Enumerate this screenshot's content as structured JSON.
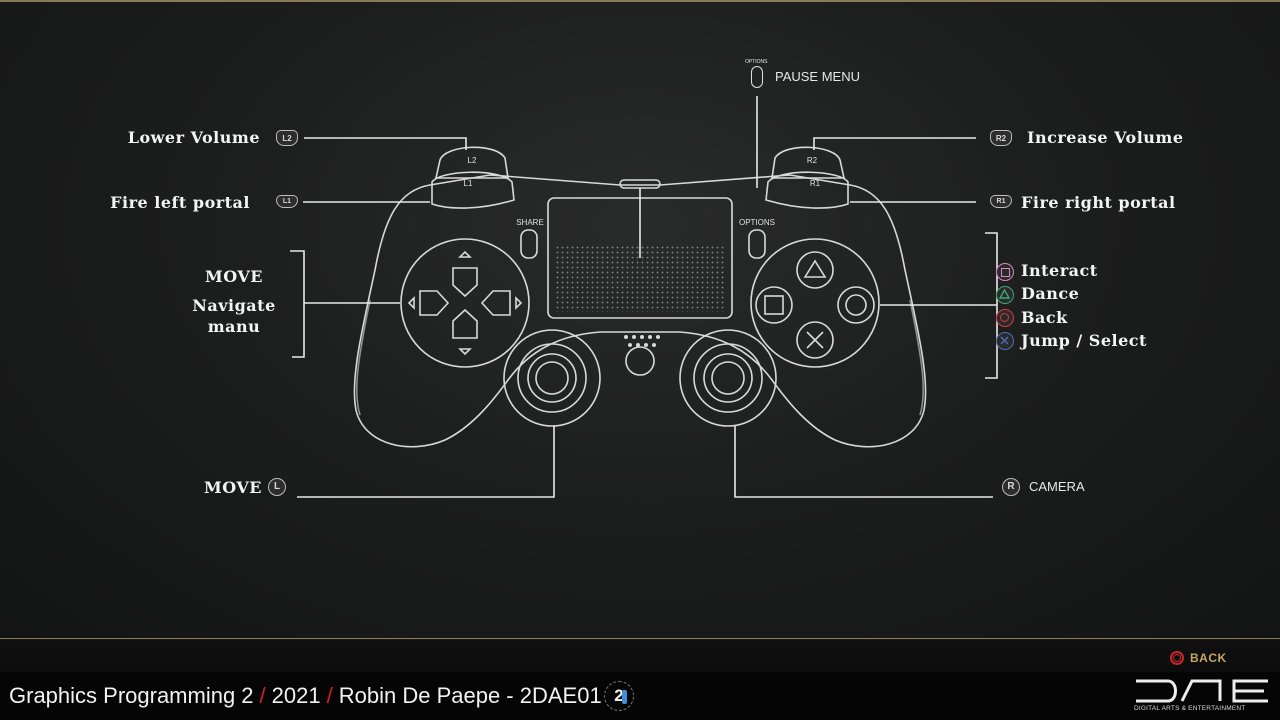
{
  "controls": {
    "left": {
      "l2": {
        "label": "Lower Volume",
        "badge": "L2"
      },
      "l1": {
        "label": "Fire left portal",
        "badge": "L1"
      },
      "dpad": {
        "line1": "MOVE",
        "line2": "Navigate",
        "line3": "manu"
      },
      "left_stick": {
        "label": "MOVE",
        "badge": "L"
      }
    },
    "right": {
      "r2": {
        "label": "Increase Volume",
        "badge": "R2"
      },
      "r1": {
        "label": "Fire right portal",
        "badge": "R1"
      },
      "face": [
        {
          "label": "Interact",
          "symbol": "square",
          "color": "#d889c7"
        },
        {
          "label": "Dance",
          "symbol": "triangle",
          "color": "#3fa67a"
        },
        {
          "label": "Back",
          "symbol": "circle",
          "color": "#d23a3f"
        },
        {
          "label": "Jump / Select",
          "symbol": "cross",
          "color": "#4c6fb4"
        }
      ],
      "right_stick": {
        "label": "CAMERA",
        "badge": "R"
      }
    },
    "options": {
      "label": "PAUSE MENU",
      "small": "OPTIONS"
    }
  },
  "controller_text": {
    "share": "SHARE",
    "options": "OPTIONS",
    "l1": "L1",
    "l2": "L2",
    "r1": "R1",
    "r2": "R2"
  },
  "footer": {
    "course": "Graphics Programming 2",
    "year": "2021",
    "author": "Robin De Paepe - 2DAE01",
    "sep": "/",
    "logo_number": "2",
    "back_label": "BACK",
    "brand_tagline": "DIGITAL ARTS & ENTERTAINMENT"
  },
  "colors": {
    "accent_line": "#8a7a55",
    "back_red": "#c8262a",
    "back_text": "#c8a660"
  }
}
